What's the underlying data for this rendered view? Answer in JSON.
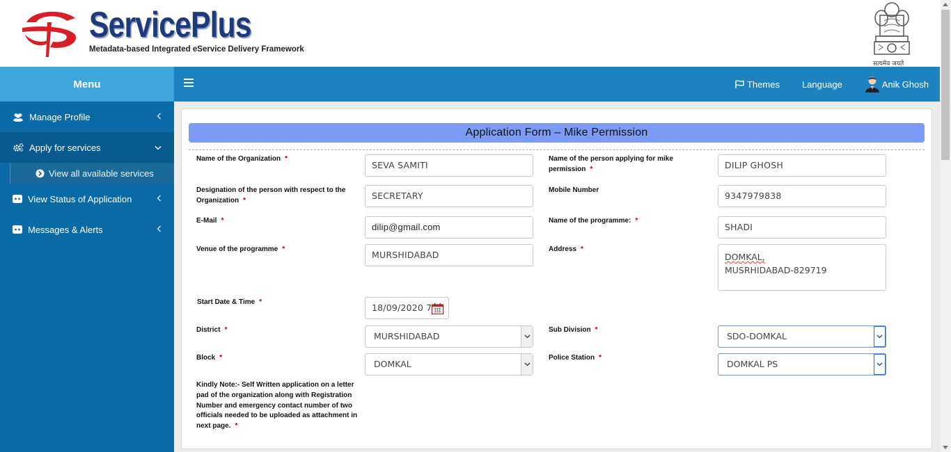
{
  "header": {
    "brand_title": "ServicePlus",
    "brand_subtitle": "Metadata-based Integrated eService Delivery Framework",
    "emblem_caption": "सत्यमेव जयते"
  },
  "navbar": {
    "menu_label": "Menu",
    "themes_label": "Themes",
    "language_label": "Language",
    "user_name": "Anik Ghosh"
  },
  "sidebar": {
    "items": [
      {
        "label": "Manage Profile",
        "icon": "users-icon"
      },
      {
        "label": "Apply for services",
        "icon": "gears-icon"
      },
      {
        "label": "View all available services",
        "icon": "arrow-circle-icon"
      },
      {
        "label": "View Status of Application",
        "icon": "dots-icon"
      },
      {
        "label": "Messages & Alerts",
        "icon": "dots-icon"
      }
    ]
  },
  "form": {
    "title": "Application Form – Mike Permission",
    "fields": {
      "org_name": {
        "label": "Name of the Organization",
        "value": "SEVA SAMITI"
      },
      "applicant_name": {
        "label": "Name of the person applying for mike permission",
        "value": "DILIP GHOSH"
      },
      "designation": {
        "label": "Designation of the person with respect to the Organization",
        "value": "SECRETARY"
      },
      "mobile": {
        "label": "Mobile Number",
        "value": "9347979838"
      },
      "email": {
        "label": "E-Mail",
        "value": "dilip@gmail.com"
      },
      "programme_name": {
        "label": "Name of the programme:",
        "value": "SHADI"
      },
      "venue": {
        "label": "Venue of the programme",
        "value": "MURSHIDABAD"
      },
      "address": {
        "label": "Address",
        "line1": "DOMKAL,",
        "line2": "MUSRHIDABAD-829719"
      },
      "start_datetime": {
        "label": "Start Date & Time",
        "value": "18/09/2020 7"
      },
      "district": {
        "label": "District",
        "value": "MURSHIDABAD"
      },
      "sub_division": {
        "label": "Sub Division",
        "value": "SDO-DOMKAL"
      },
      "block": {
        "label": "Block",
        "value": "DOMKAL"
      },
      "police_station": {
        "label": "Police Station",
        "value": "DOMKAL PS"
      }
    },
    "note": "Kindly Note:- Self Written application on a letter pad of the organization along with Registration Number and emergency contact number of two officials needed to be uploaded as attachment in next page.",
    "required_marker": "*"
  },
  "colors": {
    "navbar": "#1d82c0",
    "sidebar": "#0a6aa5",
    "menu_header": "#3fa6dc",
    "form_title_bar": "#7d9bf4",
    "required": "#c00000"
  }
}
